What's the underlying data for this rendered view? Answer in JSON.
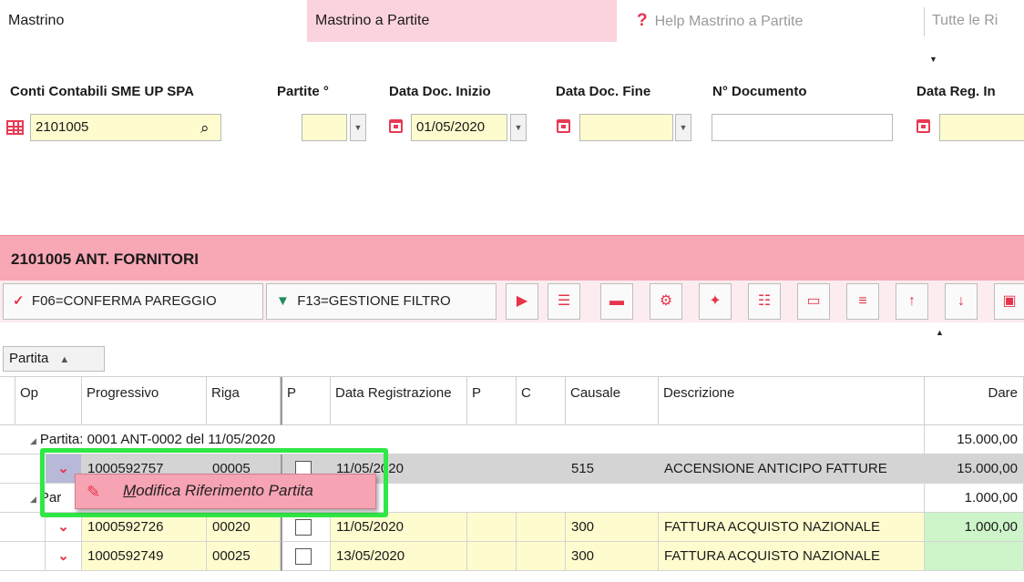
{
  "tabs": {
    "mastrino": "Mastrino",
    "partite": "Mastrino a Partite",
    "help": "Help Mastrino a Partite",
    "tutte": "Tutte le Ri"
  },
  "filters": {
    "conti_label": "Conti Contabili SME UP SPA",
    "conti_value": "2101005",
    "partite_label": "Partite °",
    "partite_value": "",
    "data_inizio_label": "Data Doc. Inizio",
    "data_inizio_value": "01/05/2020",
    "data_fine_label": "Data Doc. Fine",
    "data_fine_value": "",
    "documento_label": "N° Documento",
    "documento_value": "",
    "data_reg_label": "Data Reg. In"
  },
  "account": {
    "title": "2101005 ANT. FORNITORI"
  },
  "toolbar": {
    "conferma_label": "F06=CONFERMA PAREGGIO",
    "filtro_label": "F13=GESTIONE FILTRO"
  },
  "groupby": {
    "label": "Partita"
  },
  "grid": {
    "headers": {
      "op": "Op",
      "progressivo": "Progressivo",
      "riga": "Riga",
      "p1": "P",
      "data_reg": "Data Registrazione",
      "p2": "P",
      "c": "C",
      "causale": "Causale",
      "descrizione": "Descrizione",
      "dare": "Dare"
    },
    "group1": {
      "label": "Partita: 0001 ANT-0002 del 11/05/2020",
      "total": "15.000,00"
    },
    "row1": {
      "progressivo": "1000592757",
      "riga": "00005",
      "data": "11/05/2020",
      "causale": "515",
      "descrizione": "ACCENSIONE ANTICIPO FATTURE",
      "dare": "15.000,00"
    },
    "group2": {
      "label": "Par",
      "total": "1.000,00"
    },
    "row2": {
      "progressivo": "1000592726",
      "riga": "00020",
      "data": "11/05/2020",
      "causale": "300",
      "descrizione": "FATTURA ACQUISTO NAZIONALE",
      "dare": "1.000,00"
    },
    "row3": {
      "progressivo": "1000592749",
      "riga": "00025",
      "data": "13/05/2020",
      "causale": "300",
      "descrizione": "FATTURA ACQUISTO NAZIONALE",
      "dare": ""
    }
  },
  "context_menu": {
    "accel": "M",
    "label_rest": "odifica Riferimento Partita"
  },
  "colors": {
    "accent": "#e8334b",
    "header_pink": "#f8a7b4",
    "field_yellow": "#fefcce",
    "highlight_green": "#2ee845"
  }
}
